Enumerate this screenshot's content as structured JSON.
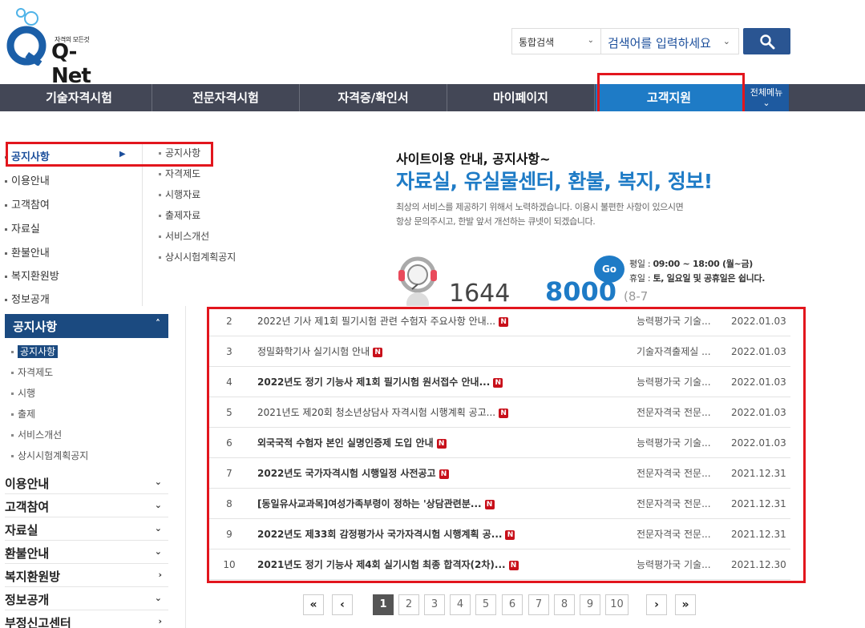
{
  "logo": {
    "tagline": "자격의 모든것",
    "name": "Q-Net"
  },
  "search": {
    "scope": "통합검색",
    "placeholder": "검색어를 입력하세요"
  },
  "gnb": {
    "items": [
      {
        "label": "기술자격시험"
      },
      {
        "label": "전문자격시험"
      },
      {
        "label": "자격증/확인서"
      },
      {
        "label": "마이페이지"
      },
      {
        "label": "고객지원"
      }
    ],
    "all_menu": "전체메뉴"
  },
  "mega_menu": {
    "col1": [
      "공지사항",
      "이용안내",
      "고객참여",
      "자료실",
      "환불안내",
      "복지환원방",
      "정보공개"
    ],
    "col2": [
      "공지사항",
      "자격제도",
      "시행자료",
      "출제자료",
      "서비스개선",
      "상시시험계획공지"
    ],
    "promo": {
      "line1": "사이트이용 안내, 공지사항~",
      "line2": "자료실, 유실물센터, 환불, 복지, 정보!",
      "desc1": "최상의 서비스를 제공하기 위해서 노력하겠습니다. 이용시 불편한 사항이 있으시면",
      "desc2": "항상 문의주시고, 한발 앞서 개선하는 큐넷이 되겠습니다."
    },
    "phone": {
      "part1": "1644",
      "part2": "8000",
      "part3": "(8-7"
    },
    "go": "Go",
    "hours": {
      "weekday_label": "평일 :",
      "weekday": "09:00 ~ 18:00 (월~금)",
      "holiday_label": "휴일 :",
      "holiday": "토, 일요일 및 공휴일은 쉽니다."
    }
  },
  "sidebar": {
    "header": "공지사항",
    "sub_items": [
      "공지사항",
      "자격제도",
      "시행",
      "출제",
      "서비스개선",
      "상시시험계획공지"
    ],
    "groups": [
      "이용안내",
      "고객참여",
      "자료실",
      "환불안내",
      "복지환원방",
      "정보공개",
      "부정신고센터"
    ]
  },
  "notices": {
    "rows": [
      {
        "no": "2",
        "title": "2022년 기사 제1회 필기시험 관련 수험자 주요사항 안내...",
        "org": "능력평가국 기술...",
        "date": "2022.01.03",
        "bold": false
      },
      {
        "no": "3",
        "title": "정밀화학기사 실기시험 안내",
        "org": "기술자격출제실 ...",
        "date": "2022.01.03",
        "bold": false
      },
      {
        "no": "4",
        "title": "2022년도 정기 기능사 제1회 필기시험 원서접수 안내...",
        "org": "능력평가국 기술...",
        "date": "2022.01.03",
        "bold": true
      },
      {
        "no": "5",
        "title": "2021년도 제20회 청소년상담사 자격시험 시행계획 공고...",
        "org": "전문자격국 전문...",
        "date": "2022.01.03",
        "bold": false
      },
      {
        "no": "6",
        "title": "외국국적 수험자 본인 실명인증제 도입 안내",
        "org": "능력평가국 기술...",
        "date": "2022.01.03",
        "bold": true
      },
      {
        "no": "7",
        "title": "2022년도 국가자격시험 시행일정 사전공고",
        "org": "전문자격국 전문...",
        "date": "2021.12.31",
        "bold": true
      },
      {
        "no": "8",
        "title": "[동일유사교과목]여성가족부령이 정하는 '상담관련분...",
        "org": "전문자격국 전문...",
        "date": "2021.12.31",
        "bold": true
      },
      {
        "no": "9",
        "title": "2022년도 제33회 감정평가사 국가자격시험 시행계획 공...",
        "org": "전문자격국 전문...",
        "date": "2021.12.31",
        "bold": true
      },
      {
        "no": "10",
        "title": "2021년도 정기 기능사 제4회 실기시험 최종 합격자(2차)...",
        "org": "능력평가국 기술...",
        "date": "2021.12.30",
        "bold": true
      }
    ],
    "new_badge": "N"
  },
  "pagination": {
    "first": "«",
    "prev": "‹",
    "next": "›",
    "last": "»",
    "pages": [
      "1",
      "2",
      "3",
      "4",
      "5",
      "6",
      "7",
      "8",
      "9",
      "10"
    ],
    "current": "1"
  },
  "colors": {
    "accent": "#1e7bc6",
    "nav_bg": "#434756",
    "highlight": "#e2161d",
    "sidebar_head": "#1b4a80"
  }
}
